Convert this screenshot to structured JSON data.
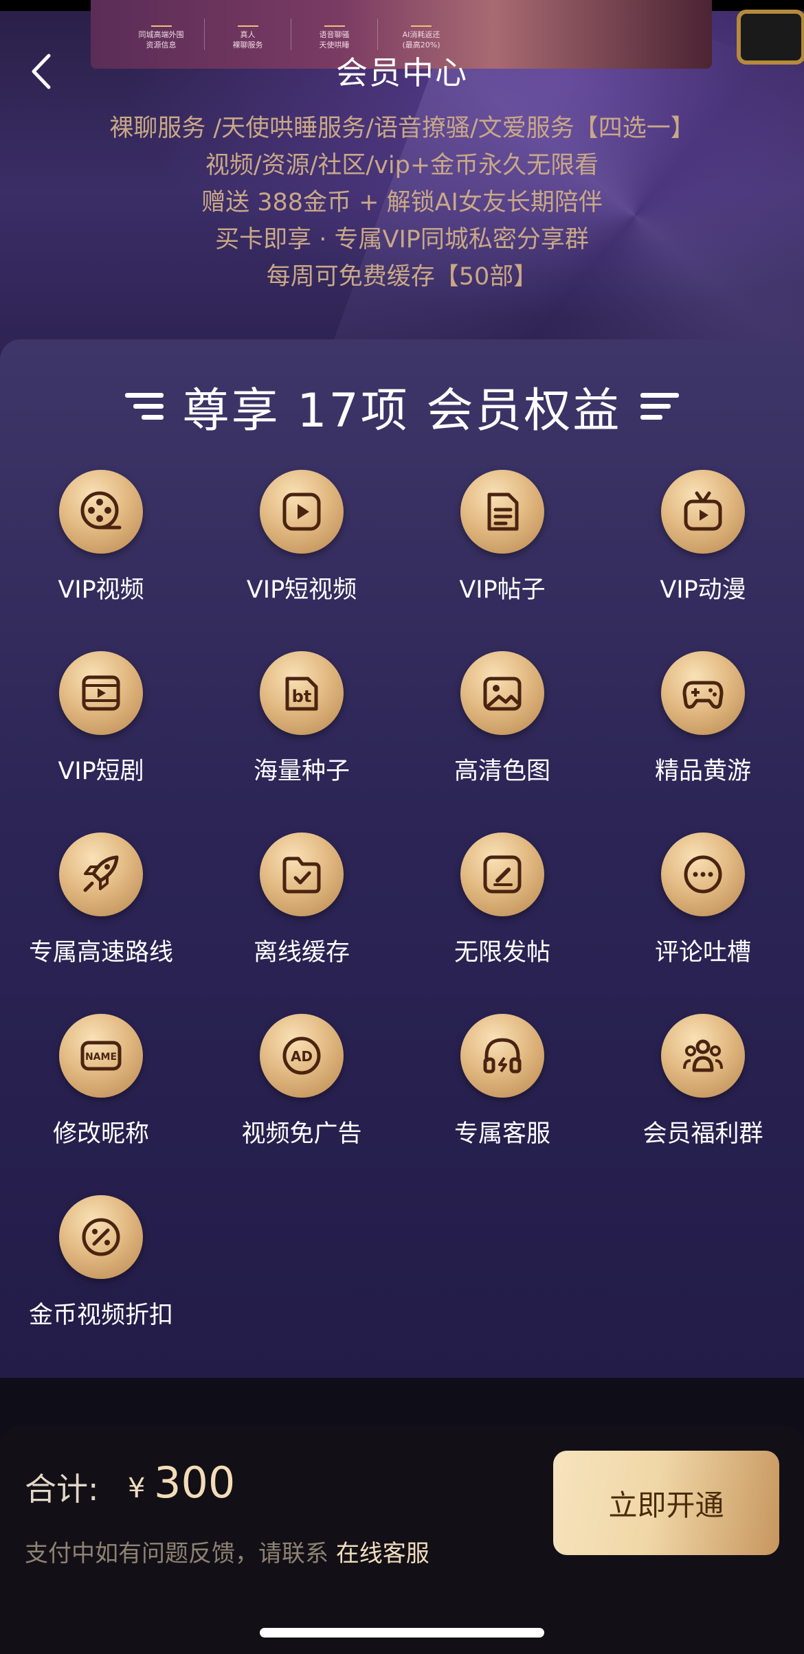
{
  "header": {
    "title": "会员中心",
    "banner_features": [
      {
        "top": "同城高端外围",
        "bottom": "资源信息"
      },
      {
        "top": "真人",
        "bottom": "裸聊服务"
      },
      {
        "top": "语音聊骚",
        "bottom": "天使哄睡"
      },
      {
        "top": "AI消耗返还",
        "bottom": "(最高20%)"
      }
    ]
  },
  "promo_lines": [
    "裸聊服务 /天使哄睡服务/语音撩骚/文爱服务【四选一】",
    "视频/资源/社区/vip+金币永久无限看",
    "赠送 388金币 + 解锁AI女友长期陪伴",
    "买卡即享 · 专属VIP同城私密分享群",
    "每周可免费缓存【50部】"
  ],
  "benefits": {
    "title": "尊享 17项 会员权益",
    "items": [
      {
        "label": "VIP视频",
        "icon": "film-reel-icon"
      },
      {
        "label": "VIP短视频",
        "icon": "play-button-icon"
      },
      {
        "label": "VIP帖子",
        "icon": "document-icon"
      },
      {
        "label": "VIP动漫",
        "icon": "tv-icon"
      },
      {
        "label": "VIP短剧",
        "icon": "film-strip-icon"
      },
      {
        "label": "海量种子",
        "icon": "bt-torrent-icon"
      },
      {
        "label": "高清色图",
        "icon": "image-icon"
      },
      {
        "label": "精品黄游",
        "icon": "gamepad-icon"
      },
      {
        "label": "专属高速路线",
        "icon": "rocket-icon"
      },
      {
        "label": "离线缓存",
        "icon": "folder-check-icon"
      },
      {
        "label": "无限发帖",
        "icon": "edit-post-icon"
      },
      {
        "label": "评论吐槽",
        "icon": "comment-icon"
      },
      {
        "label": "修改昵称",
        "icon": "name-tag-icon"
      },
      {
        "label": "视频免广告",
        "icon": "ad-free-icon"
      },
      {
        "label": "专属客服",
        "icon": "headset-icon"
      },
      {
        "label": "会员福利群",
        "icon": "group-icon"
      },
      {
        "label": "金币视频折扣",
        "icon": "discount-icon"
      }
    ]
  },
  "checkout": {
    "total_label": "合计:",
    "currency": "¥",
    "amount": "300",
    "help_text": "支付中如有问题反馈，请联系 ",
    "help_link": "在线客服",
    "pay_button": "立即开通"
  },
  "colors": {
    "gold": "#e2b982",
    "panel": "#2c2556",
    "promo_text": "#c9a887"
  }
}
